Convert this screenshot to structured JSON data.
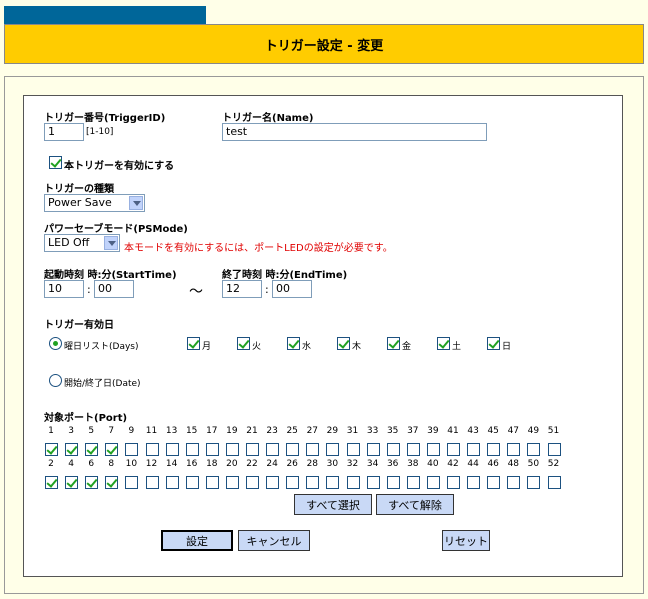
{
  "title": "トリガー設定 - 変更",
  "trigger_id": {
    "label": "トリガー番号(TriggerID)",
    "value": "1",
    "range": "[1-10]"
  },
  "trigger_name": {
    "label": "トリガー名(Name)",
    "value": "test"
  },
  "enable": {
    "label": "本トリガーを有効にする",
    "checked": true
  },
  "trigger_type": {
    "label": "トリガーの種類",
    "value": "Power Save"
  },
  "psmode": {
    "label": "パワーセーブモード(PSMode)",
    "value": "LED Off",
    "note": "本モードを有効にするには、ポートLEDの設定が必要です。"
  },
  "start_time": {
    "label": "起動時刻 時:分(StartTime)",
    "hour": "10",
    "minute": "00"
  },
  "end_time": {
    "label": "終了時刻 時:分(EndTime)",
    "hour": "12",
    "minute": "00"
  },
  "time_sep": ":",
  "tilde": "～",
  "days": {
    "label": "トリガー有効日",
    "list_label": "曜日リスト(Days)",
    "date_label": "開始/終了日(Date)",
    "selected": "list",
    "items": [
      {
        "label": "月",
        "checked": true
      },
      {
        "label": "火",
        "checked": true
      },
      {
        "label": "水",
        "checked": true
      },
      {
        "label": "木",
        "checked": true
      },
      {
        "label": "金",
        "checked": true
      },
      {
        "label": "土",
        "checked": true
      },
      {
        "label": "日",
        "checked": true
      }
    ]
  },
  "ports": {
    "label": "対象ポート(Port)",
    "odd": [
      "1",
      "3",
      "5",
      "7",
      "9",
      "11",
      "13",
      "15",
      "17",
      "19",
      "21",
      "23",
      "25",
      "27",
      "29",
      "31",
      "33",
      "35",
      "37",
      "39",
      "41",
      "43",
      "45",
      "47",
      "49",
      "51"
    ],
    "even": [
      "2",
      "4",
      "6",
      "8",
      "10",
      "12",
      "14",
      "16",
      "18",
      "20",
      "22",
      "24",
      "26",
      "28",
      "30",
      "32",
      "34",
      "36",
      "38",
      "40",
      "42",
      "44",
      "46",
      "48",
      "50",
      "52"
    ],
    "checked_count": 4
  },
  "buttons": {
    "select_all": "すべて選択",
    "clear_all": "すべて解除",
    "submit": "設定",
    "cancel": "キャンセル",
    "reset": "リセット"
  },
  "colors": {
    "header": "#ffcc00",
    "tab": "#006699",
    "button": "#c9d9f6",
    "note": "#e00000"
  }
}
